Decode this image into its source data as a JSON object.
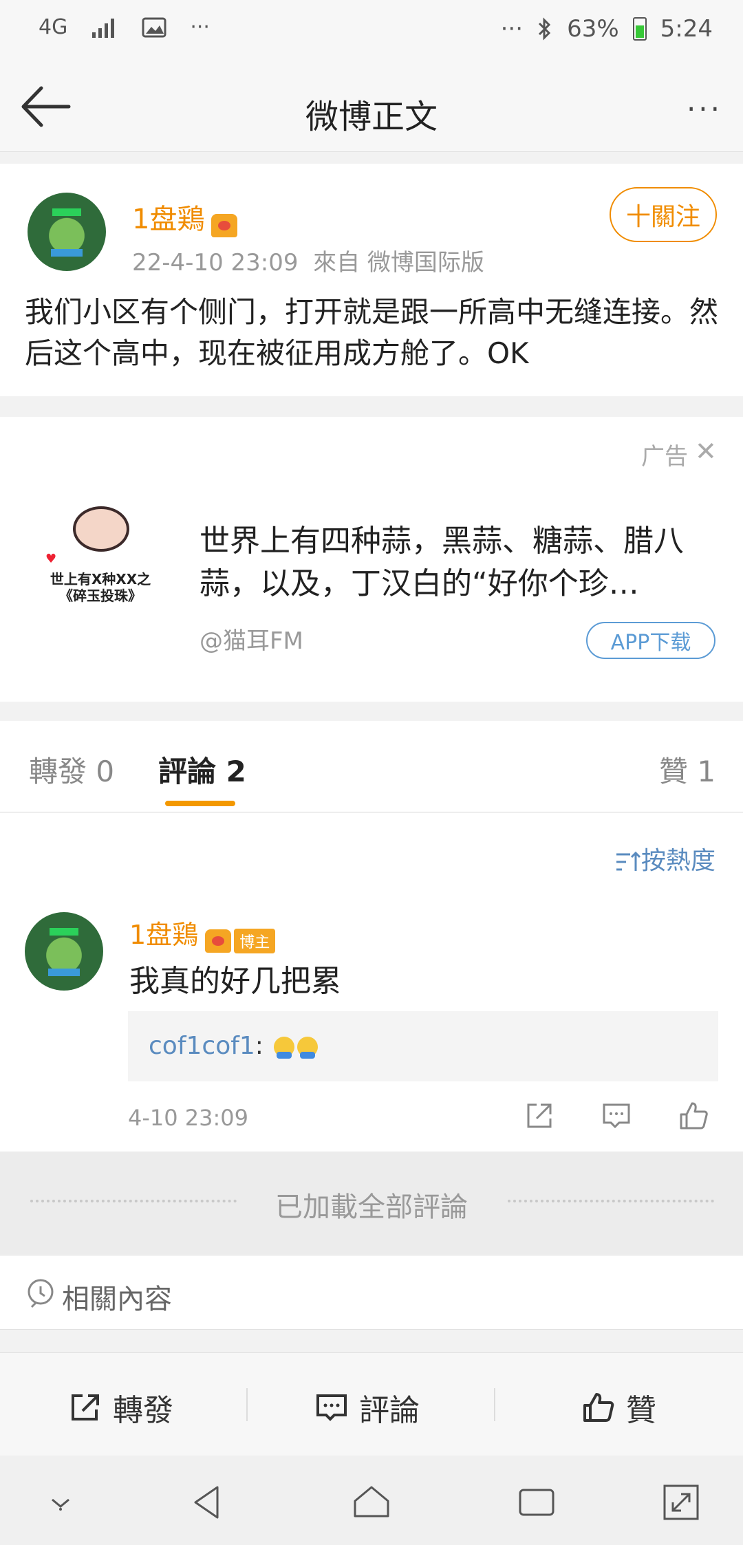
{
  "status_bar": {
    "network": "4G",
    "dots_left": "···",
    "dots_right": "···",
    "battery": "63%",
    "time": "5:24"
  },
  "header": {
    "title": "微博正文",
    "more": "···"
  },
  "post": {
    "username": "1盘鶏",
    "timestamp": "22-4-10 23:09",
    "source": "來自 微博国际版",
    "follow_label": "十關注",
    "text": "我们小区有个侧门，打开就是跟一所高中无缝连接。然后这个高中，现在被征用成方舱了。OK"
  },
  "ad": {
    "label": "广告",
    "close": "✕",
    "image_text": "世上有X种XX之\n《碎玉投珠》",
    "text": "世界上有四种蒜，黑蒜、糖蒜、腊八蒜，以及，丁汉白的“好你个珍…",
    "source": "@猫耳FM",
    "button": "APP下载"
  },
  "tabs": {
    "repost": "轉發 0",
    "comments": "評論 2",
    "likes": "贊 1"
  },
  "comments": {
    "sort_label": "按熱度",
    "items": [
      {
        "username": "1盘鶏",
        "badge": "博主",
        "text": "我真的好几把累",
        "reply_user": "cof1cof1",
        "reply_sep": ":",
        "time": "4-10 23:09"
      }
    ]
  },
  "loaded_all": "已加載全部評論",
  "related": "相關內容",
  "actions": {
    "repost": "轉發",
    "comment": "評論",
    "like": "贊"
  },
  "colors": {
    "accent_orange": "#f08c00",
    "link_blue": "#5a8bbf",
    "tab_indicator": "#f39800"
  }
}
